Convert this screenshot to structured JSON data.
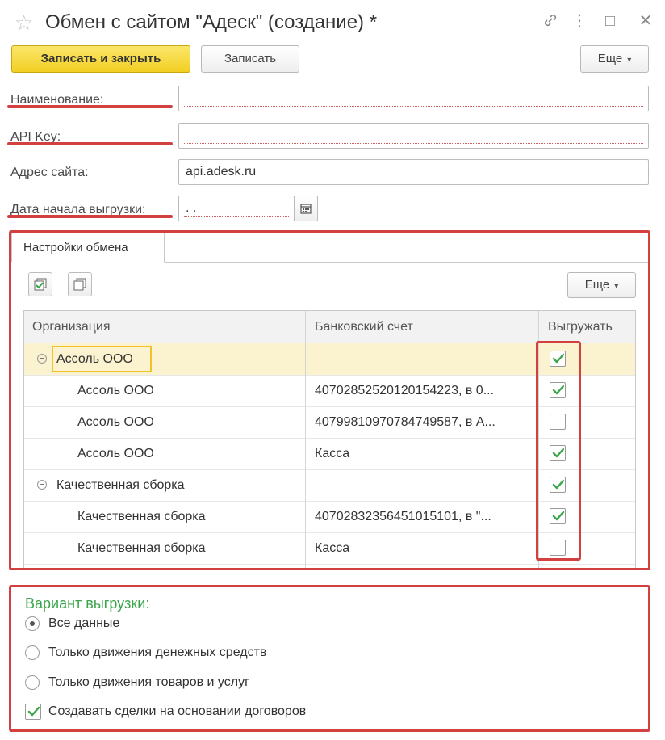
{
  "window": {
    "title": "Обмен с сайтом \"Адеск\" (создание) *",
    "star_icon": "☆",
    "link_icon": "🔗",
    "menu_icon": "⋮",
    "maximize_icon": "□",
    "close_icon": "✕"
  },
  "toolbar": {
    "save_close_label": "Записать и закрыть",
    "save_label": "Записать",
    "more_label": "Еще"
  },
  "form": {
    "name_label": "Наименование:",
    "name_value": "",
    "api_key_label": "API Key:",
    "api_key_value": "",
    "site_label": "Адрес сайта:",
    "site_value": "api.adesk.ru",
    "date_label": "Дата начала выгрузки:",
    "date_value": "  .  .    "
  },
  "exchange_settings": {
    "tab_label": "Настройки обмена",
    "more_label": "Еще",
    "columns": {
      "organization": "Организация",
      "bank_account": "Банковский счет",
      "export": "Выгружать"
    },
    "rows": [
      {
        "organization": "Ассоль ООО",
        "account": "",
        "export": true,
        "group": true,
        "selected": true
      },
      {
        "organization": "Ассоль ООО",
        "account": "40702852520120154223, в 0...",
        "export": true,
        "group": false,
        "selected": false
      },
      {
        "organization": "Ассоль ООО",
        "account": "40799810970784749587, в А...",
        "export": false,
        "group": false,
        "selected": false
      },
      {
        "organization": "Ассоль ООО",
        "account": "Касса",
        "export": true,
        "group": false,
        "selected": false
      },
      {
        "organization": "Качественная сборка",
        "account": "",
        "export": true,
        "group": true,
        "selected": false
      },
      {
        "organization": "Качественная сборка",
        "account": "40702832356451015101, в \"...",
        "export": true,
        "group": false,
        "selected": false
      },
      {
        "organization": "Качественная сборка",
        "account": "Касса",
        "export": false,
        "group": false,
        "selected": false
      }
    ]
  },
  "export_variant": {
    "title": "Вариант выгрузки:",
    "options": [
      {
        "label": "Все данные",
        "selected": true
      },
      {
        "label": "Только движения денежных средств",
        "selected": false
      },
      {
        "label": "Только движения товаров и услуг",
        "selected": false
      }
    ],
    "create_deals_label": "Создавать сделки на основании договоров",
    "create_deals_checked": true
  },
  "colors": {
    "accent_yellow": "#f2cf24",
    "highlight_red": "#d24040",
    "check_green": "#3aa64a",
    "selected_row": "#fbf2cf"
  }
}
